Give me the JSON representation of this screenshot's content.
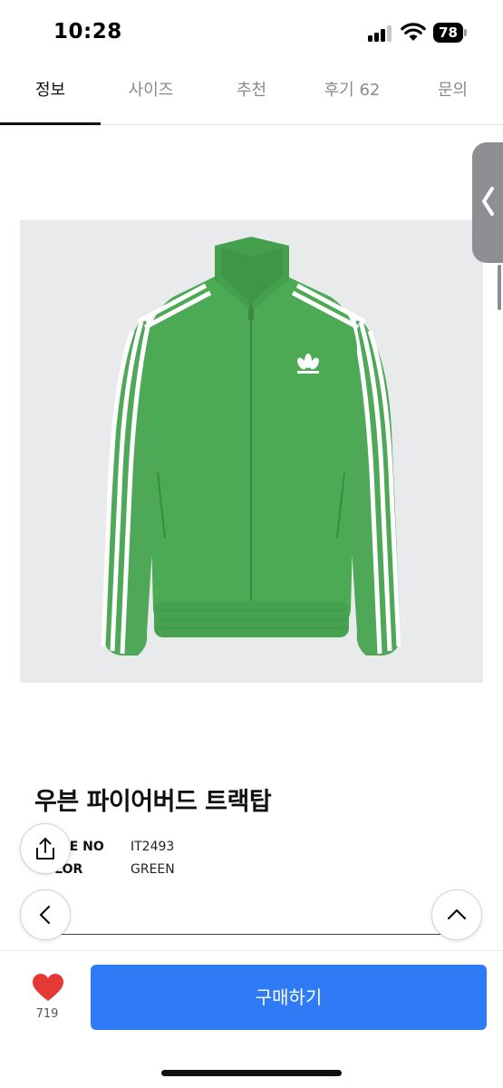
{
  "status_bar": {
    "time": "10:28",
    "battery_level": "78",
    "signal_icon": "cellular-signal-icon",
    "wifi_icon": "wifi-icon"
  },
  "tabs": [
    {
      "label": "정보",
      "active": true
    },
    {
      "label": "사이즈",
      "active": false
    },
    {
      "label": "추천",
      "active": false
    },
    {
      "label": "후기 62",
      "active": false
    },
    {
      "label": "문의",
      "active": false
    }
  ],
  "product": {
    "image_icon": "green-track-jacket-image",
    "title": "우븐 파이어버드 트랙탑",
    "specs": [
      {
        "label": "STYLE NO",
        "value": "IT2493"
      },
      {
        "label": "COLOR",
        "value": "GREEN"
      }
    ]
  },
  "floating": {
    "share_icon": "share-icon",
    "back_icon": "chevron-left-icon",
    "top_icon": "chevron-up-icon",
    "side_handle_icon": "chevron-left-icon"
  },
  "bottom_bar": {
    "like_icon": "heart-icon",
    "like_count": "719",
    "buy_label": "구매하기"
  },
  "colors": {
    "accent": "#2f7bf6",
    "heart": "#e53935",
    "jacket_green": "#4caa55"
  }
}
